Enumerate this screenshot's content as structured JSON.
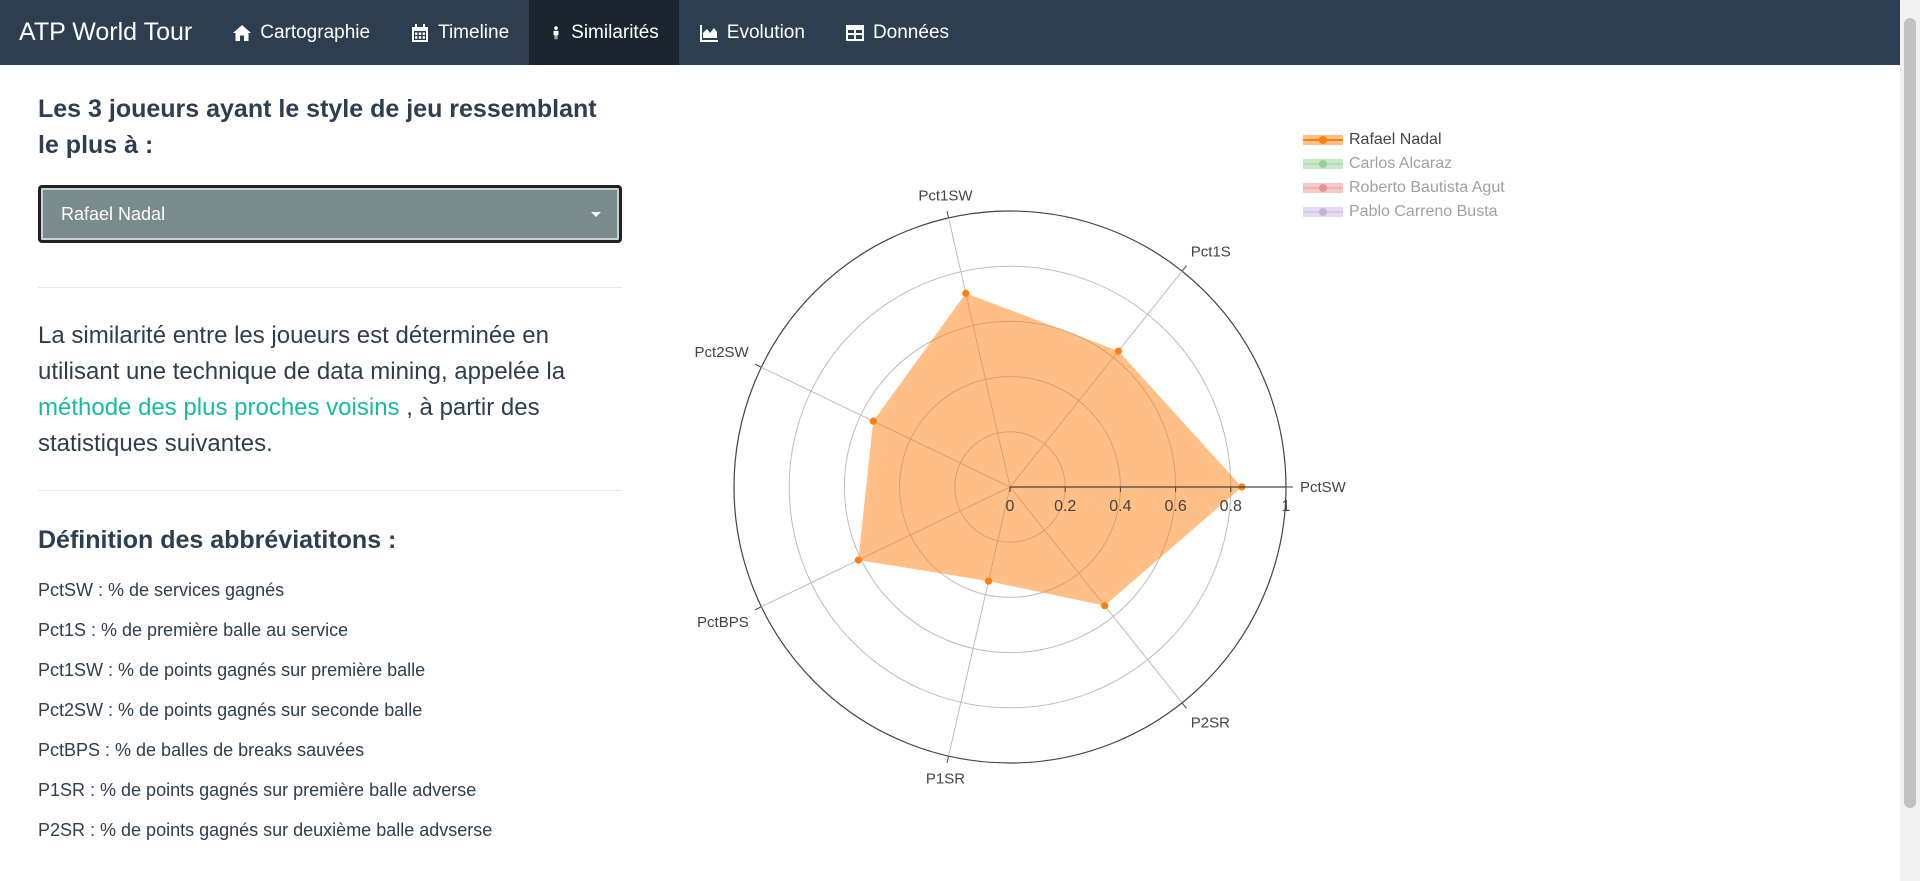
{
  "navbar": {
    "brand": "ATP World Tour",
    "tabs": [
      {
        "label": "Cartographie",
        "icon": "home-icon"
      },
      {
        "label": "Timeline",
        "icon": "calendar-icon"
      },
      {
        "label": "Similarités",
        "icon": "person-icon",
        "active": true
      },
      {
        "label": "Evolution",
        "icon": "area-chart-icon"
      },
      {
        "label": "Données",
        "icon": "table-icon"
      }
    ]
  },
  "sidebar": {
    "heading": "Les 3 joueurs ayant le style de jeu ressemblant le plus à :",
    "select_value": "Rafael Nadal",
    "description_before": "La similarité entre les joueurs est déterminée en utilisant une technique de data mining, appelée la",
    "description_link": "méthode des plus proches voisins",
    "description_after": ", à partir des statistiques suivantes.",
    "definitions_title": "Définition des abbréviatitons :",
    "definitions": [
      "PctSW : % de services gagnés",
      "Pct1S : % de première balle au service",
      "Pct1SW : % de points gagnés sur première balle",
      "Pct2SW : % de points gagnés sur seconde balle",
      "PctBPS : % de balles de breaks sauvées",
      "P1SR : % de points gagnés sur première balle adverse",
      "P2SR : % de points gagnés sur deuxième balle advserse"
    ]
  },
  "colors": {
    "navbar": "#2c3e50",
    "link": "#18bc9c",
    "nadal": "#ff7f0e",
    "alcaraz": "#2ca02c",
    "bautista": "#d62728",
    "carreno": "#9467bd"
  },
  "chart_data": {
    "type": "radar",
    "axes": [
      "PctSW",
      "Pct1S",
      "Pct1SW",
      "Pct2SW",
      "PctBPS",
      "P1SR",
      "P2SR"
    ],
    "radial_ticks": [
      "0",
      "0.2",
      "0.4",
      "0.6",
      "0.8",
      "1"
    ],
    "rlim": [
      0,
      1
    ],
    "legend_position": "top-right",
    "series": [
      {
        "name": "Rafael Nadal",
        "color": "#ff7f0e",
        "visible": true,
        "values": [
          0.84,
          0.63,
          0.72,
          0.55,
          0.61,
          0.35,
          0.55
        ]
      },
      {
        "name": "Carlos Alcaraz",
        "color": "#2ca02c",
        "visible": false,
        "values": []
      },
      {
        "name": "Roberto Bautista Agut",
        "color": "#d62728",
        "visible": false,
        "values": []
      },
      {
        "name": "Pablo Carreno Busta",
        "color": "#9467bd",
        "visible": false,
        "values": []
      }
    ]
  }
}
